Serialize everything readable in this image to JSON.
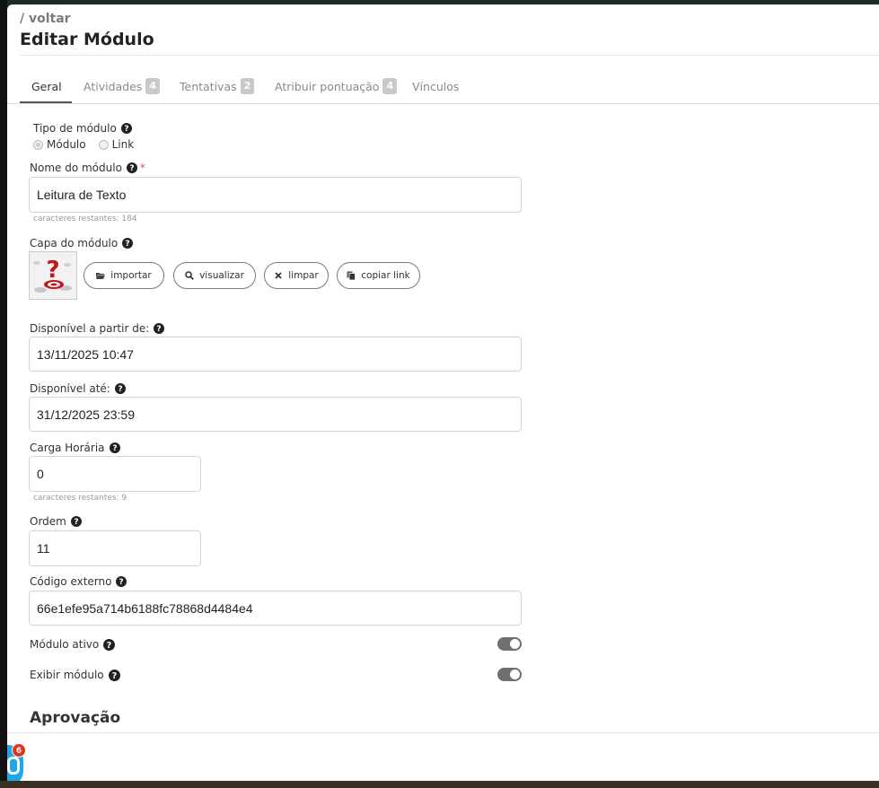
{
  "header": {
    "back_label": "/ voltar",
    "title": "Editar Módulo"
  },
  "tabs": [
    {
      "label": "Geral",
      "badge": ""
    },
    {
      "label": "Atividades",
      "badge": "4"
    },
    {
      "label": "Tentativas",
      "badge": "2"
    },
    {
      "label": "Atribuir pontuação",
      "badge": "4"
    },
    {
      "label": "Vínculos",
      "badge": ""
    }
  ],
  "form": {
    "module_type": {
      "label": "Tipo de módulo",
      "options": [
        "Módulo",
        "Link"
      ],
      "selected": "Módulo"
    },
    "module_name": {
      "label": "Nome do módulo",
      "required_mark": "*",
      "value": "Leitura de Texto",
      "hint": "caracteres restantes: 184"
    },
    "cover": {
      "label": "Capa do módulo",
      "buttons": [
        "importar",
        "visualizar",
        "limpar",
        "copiar link"
      ]
    },
    "available_from": {
      "label": "Disponível a partir de:",
      "value": "13/11/2025 10:47"
    },
    "available_until": {
      "label": "Disponível até:",
      "value": "31/12/2025 23:59"
    },
    "workload": {
      "label": "Carga Horária",
      "value": "0",
      "hint": "caracteres restantes: 9"
    },
    "order": {
      "label": "Ordem",
      "value": "11"
    },
    "external_code": {
      "label": "Código externo",
      "value": "66e1efe95a714b6188fc78868d4484e4"
    },
    "module_active": {
      "label": "Módulo ativo",
      "on": true
    },
    "show_module": {
      "label": "Exibir módulo",
      "on": true
    },
    "approval_section": "Aprovação"
  },
  "chat": {
    "badge_count": "6"
  }
}
